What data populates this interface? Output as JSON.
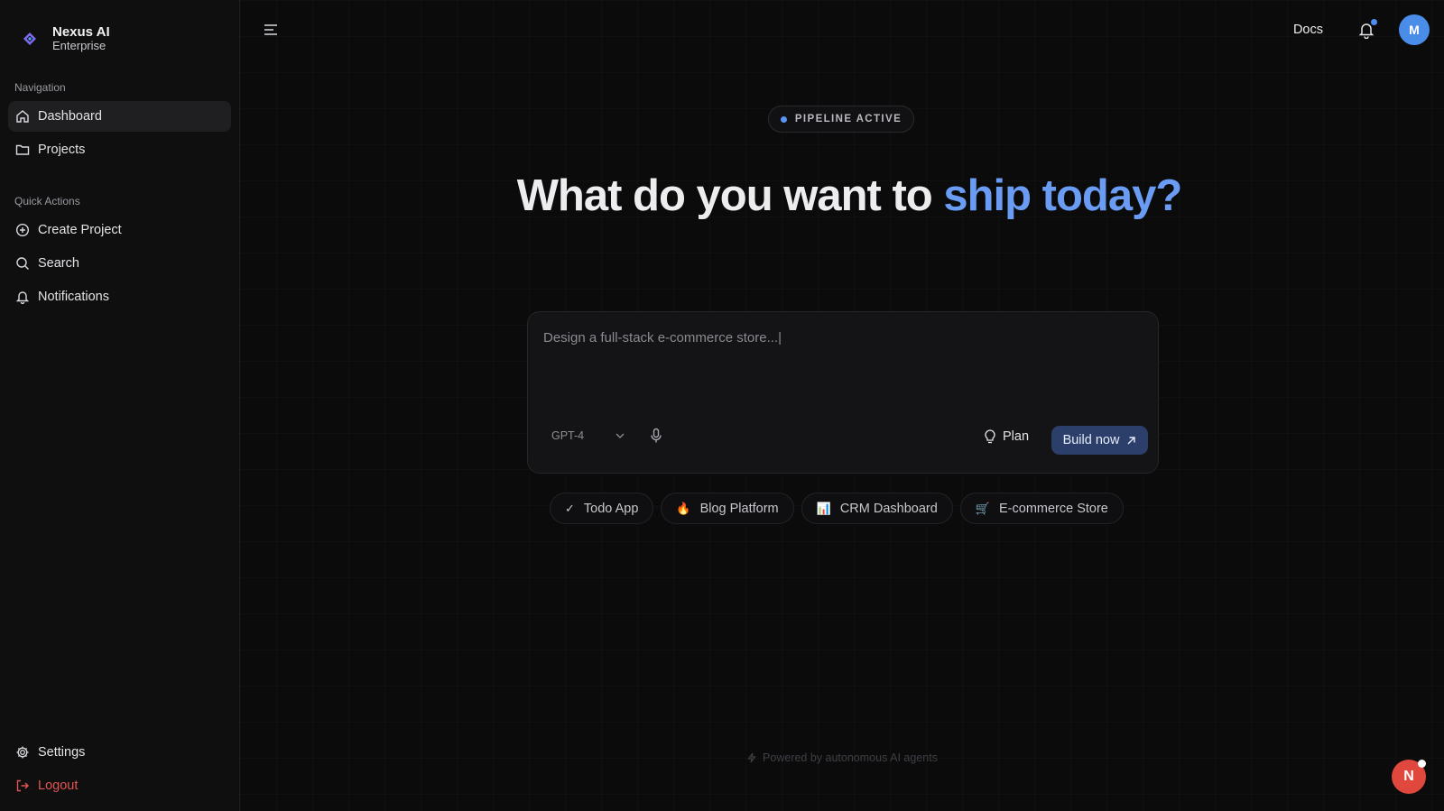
{
  "brand": {
    "name": "Nexus AI",
    "subtitle": "Enterprise"
  },
  "sidebar": {
    "nav_label": "Navigation",
    "nav_items": [
      {
        "label": "Dashboard",
        "icon": "home-icon",
        "active": true
      },
      {
        "label": "Projects",
        "icon": "folder-icon"
      }
    ],
    "quick_label": "Quick Actions",
    "quick_items": [
      {
        "label": "Create Project",
        "icon": "plus-circle-icon"
      },
      {
        "label": "Search",
        "icon": "search-icon"
      },
      {
        "label": "Notifications",
        "icon": "bell-icon"
      }
    ],
    "bottom_items": [
      {
        "label": "Settings",
        "icon": "gear-icon"
      },
      {
        "label": "Logout",
        "icon": "logout-icon"
      }
    ]
  },
  "topbar": {
    "docs_label": "Docs",
    "avatar_initial": "M"
  },
  "status": {
    "label": "PIPELINE ACTIVE"
  },
  "headline": {
    "part1": "What do you want to ",
    "accent": "ship today?"
  },
  "prompt": {
    "placeholder": "Design a full-stack e-commerce store...|",
    "model": "GPT-4",
    "plan_label": "Plan",
    "build_label": "Build now"
  },
  "chips": [
    {
      "label": "Todo App",
      "icon": "✓"
    },
    {
      "label": "Blog Platform",
      "icon": "🔥"
    },
    {
      "label": "CRM Dashboard",
      "icon": "📊"
    },
    {
      "label": "E-commerce Store",
      "icon": "🛒"
    }
  ],
  "footer": {
    "note": "Powered by autonomous AI agents"
  },
  "float_badge": {
    "initial": "N"
  },
  "colors": {
    "accent": "#6a9cf3",
    "build_bg": "#2b3f6a",
    "logout": "#e25454",
    "badge": "#e0483e"
  }
}
